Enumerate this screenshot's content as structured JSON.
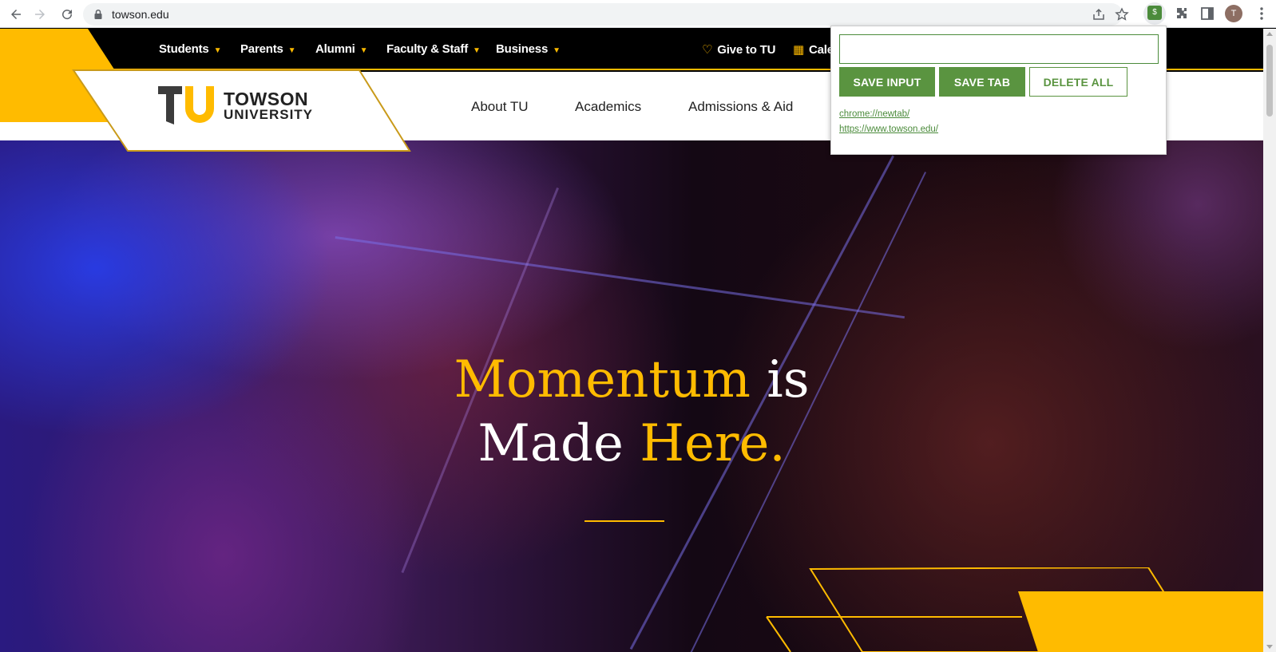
{
  "browser": {
    "url": "towson.edu",
    "avatar_letter": "T",
    "ext_badge": "$"
  },
  "utility_nav": {
    "items": [
      "Students",
      "Parents",
      "Alumni",
      "Faculty & Staff",
      "Business"
    ],
    "give": "Give to TU",
    "calendar": "Cale"
  },
  "logo": {
    "line1": "TOWSON",
    "line2": "UNIVERSITY"
  },
  "main_nav": {
    "items": [
      "About TU",
      "Academics",
      "Admissions & Aid"
    ]
  },
  "hero": {
    "word1": "Momentum",
    "word2": " is",
    "word3": "Made ",
    "word4": "Here."
  },
  "popup": {
    "input_value": "",
    "save_input": "SAVE INPUT",
    "save_tab": "SAVE TAB",
    "delete_all": "DELETE ALL",
    "links": [
      "chrome://newtab/",
      "https://www.towson.edu/"
    ]
  },
  "colors": {
    "brand_gold": "#ffbb00",
    "ext_green": "#5a9440"
  }
}
